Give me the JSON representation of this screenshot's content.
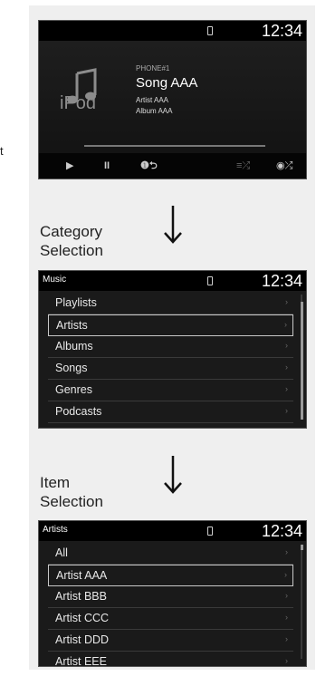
{
  "stray_text": "t",
  "now_playing": {
    "time": "12:34",
    "source": "PHONE#1",
    "song": "Song AAA",
    "artist": "Artist AAA",
    "album": "Album AAA",
    "ipod_label": "iPod",
    "controls": {
      "play": "▶",
      "pause": "II",
      "repeat": "❶⮌",
      "shuffle": "≡⤮",
      "shuffle_all": "◉⤮"
    }
  },
  "category_heading": "Category\nSelection",
  "category_screen": {
    "title": "Music",
    "time": "12:34",
    "items": [
      "Playlists",
      "Artists",
      "Albums",
      "Songs",
      "Genres",
      "Podcasts"
    ],
    "selected_index": 1
  },
  "item_heading": "Item\nSelection",
  "item_screen": {
    "title": "Artists",
    "time": "12:34",
    "items": [
      "All",
      "Artist AAA",
      "Artist BBB",
      "Artist CCC",
      "Artist DDD",
      "Artist EEE"
    ],
    "selected_index": 1
  }
}
